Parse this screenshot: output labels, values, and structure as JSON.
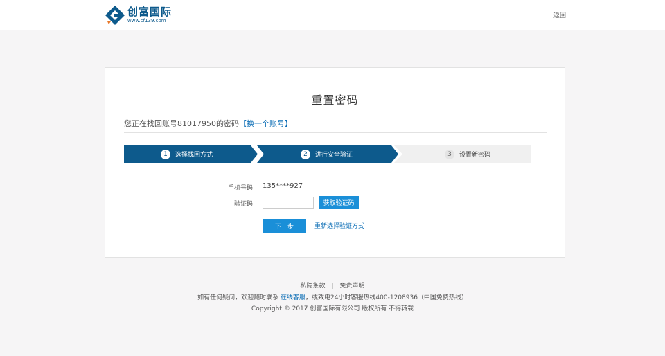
{
  "header": {
    "logo_cn": "创富国际",
    "logo_url": "www.cf139.com",
    "back_label": "返回"
  },
  "card": {
    "title": "重置密码",
    "account_prefix": "您正在找回账号81017950的密码",
    "switch_account": "【换一个账号】"
  },
  "steps": [
    {
      "num": "1",
      "label": "选择找回方式",
      "status": "done"
    },
    {
      "num": "2",
      "label": "进行安全验证",
      "status": "done"
    },
    {
      "num": "3",
      "label": "设置新密码",
      "status": "todo"
    }
  ],
  "form": {
    "phone_label": "手机号码",
    "phone_value": "135****927",
    "code_label": "验证码",
    "code_value": "",
    "get_code_label": "获取验证码",
    "next_label": "下一步",
    "reselect_label": "重新选择验证方式"
  },
  "footer": {
    "privacy": "私隐条款",
    "separator": "|",
    "disclaimer": "免责声明",
    "help_prefix": "如有任何疑问，欢迎随时联系",
    "help_link": "在线客服",
    "help_suffix": "，或致电24小时客服热线400-1208936（中国免费热线）",
    "copyright": "Copyright © 2017 创富国际有限公司 版权所有 不得转载"
  },
  "colors": {
    "brand": "#0d5a8c",
    "button": "#1a8fd8",
    "link": "#0e6fb6",
    "step_inactive": "#f0f0f0"
  }
}
